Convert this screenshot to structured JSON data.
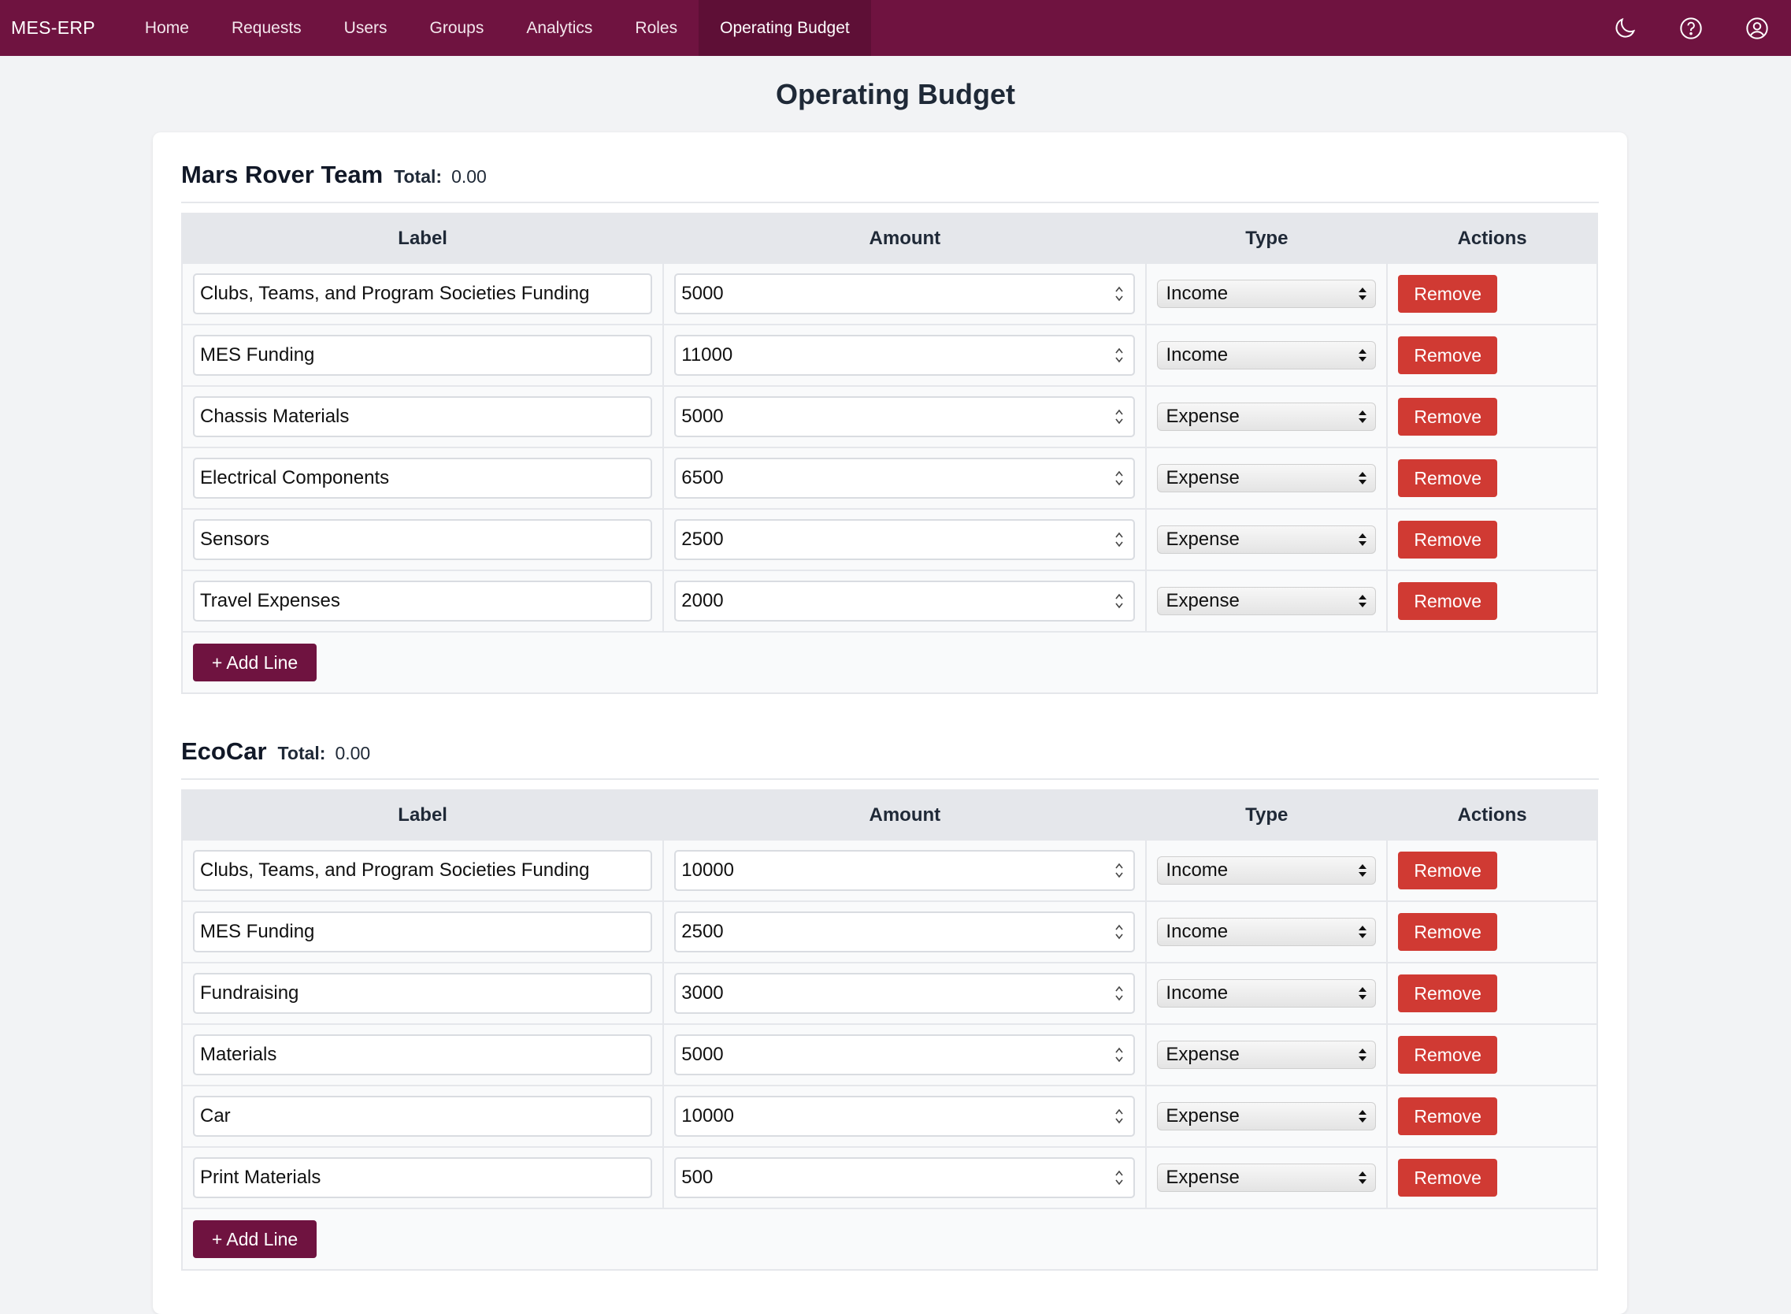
{
  "nav": {
    "brand": "MES-ERP",
    "items": [
      "Home",
      "Requests",
      "Users",
      "Groups",
      "Analytics",
      "Roles",
      "Operating Budget"
    ],
    "active": "Operating Budget",
    "icons": [
      "moon-icon",
      "help-icon",
      "user-icon"
    ]
  },
  "page": {
    "title": "Operating Budget"
  },
  "table_headers": {
    "label": "Label",
    "amount": "Amount",
    "type": "Type",
    "actions": "Actions"
  },
  "buttons": {
    "remove": "Remove",
    "add_line": "+ Add Line"
  },
  "groups": [
    {
      "name": "Mars Rover Team",
      "total_label": "Total:",
      "total": "0.00",
      "lines": [
        {
          "label": "Clubs, Teams, and Program Societies Funding",
          "amount": "5000",
          "type": "Income"
        },
        {
          "label": "MES Funding",
          "amount": "11000",
          "type": "Income"
        },
        {
          "label": "Chassis Materials",
          "amount": "5000",
          "type": "Expense"
        },
        {
          "label": "Electrical Components",
          "amount": "6500",
          "type": "Expense"
        },
        {
          "label": "Sensors",
          "amount": "2500",
          "type": "Expense"
        },
        {
          "label": "Travel Expenses",
          "amount": "2000",
          "type": "Expense"
        }
      ]
    },
    {
      "name": "EcoCar",
      "total_label": "Total:",
      "total": "0.00",
      "lines": [
        {
          "label": "Clubs, Teams, and Program Societies Funding",
          "amount": "10000",
          "type": "Income"
        },
        {
          "label": "MES Funding",
          "amount": "2500",
          "type": "Income"
        },
        {
          "label": "Fundraising",
          "amount": "3000",
          "type": "Income"
        },
        {
          "label": "Materials",
          "amount": "5000",
          "type": "Expense"
        },
        {
          "label": "Car",
          "amount": "10000",
          "type": "Expense"
        },
        {
          "label": "Print Materials",
          "amount": "500",
          "type": "Expense"
        }
      ]
    }
  ],
  "colors": {
    "brand": "#6f1340",
    "danger": "#d03a33",
    "background": "#f2f3f5"
  }
}
